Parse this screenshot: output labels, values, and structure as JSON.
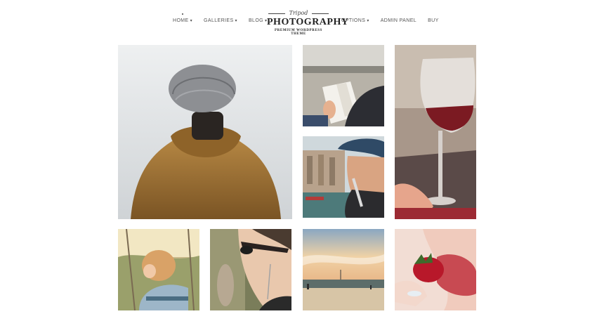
{
  "nav": {
    "left": [
      {
        "label": "HOME",
        "chevron": true
      },
      {
        "label": "GALLERIES",
        "chevron": true
      },
      {
        "label": "BLOG",
        "chevron": true
      }
    ],
    "right": [
      {
        "label": "OPTIONS",
        "chevron": true
      },
      {
        "label": "ADMIN PANEL",
        "chevron": false
      },
      {
        "label": "BUY",
        "chevron": false
      }
    ]
  },
  "logo": {
    "script": "Tripod",
    "title": "PHOTOGRAPHY",
    "tagline": "PREMIUM WORDPRESS THEME"
  },
  "gallery": {
    "photos": [
      "person-in-beanie-and-jacket",
      "reading-a-book",
      "red-wine-glass",
      "woman-in-hat-by-canal",
      "child-on-swing",
      "woman-with-sunglasses",
      "beach-sunset",
      "strawberry-bite"
    ]
  },
  "colors": {
    "background": "#ffffff",
    "nav_text": "#555555",
    "logo_text": "#222222"
  }
}
